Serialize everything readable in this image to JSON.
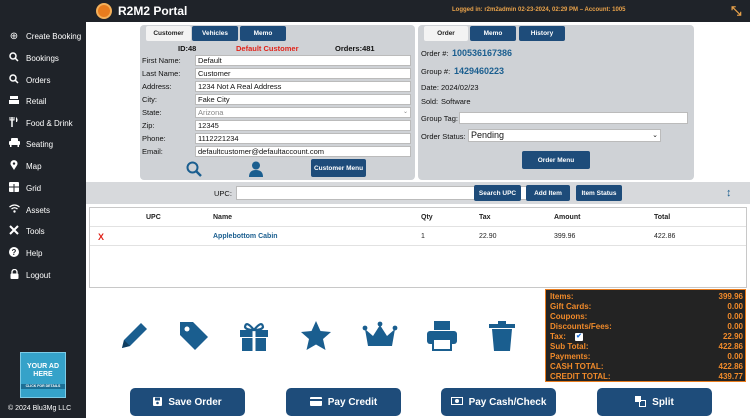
{
  "app": {
    "title": "R2M2 Portal",
    "login_info": "Logged in: r2m2admin 02-23-2024, 02:29 PM – Account: 1005"
  },
  "sidebar": {
    "items": [
      {
        "label": "Create Booking",
        "icon": "plus-circle-icon"
      },
      {
        "label": "Bookings",
        "icon": "search-icon"
      },
      {
        "label": "Orders",
        "icon": "search-icon"
      },
      {
        "label": "Retail",
        "icon": "register-icon"
      },
      {
        "label": "Food & Drink",
        "icon": "utensils-icon"
      },
      {
        "label": "Seating",
        "icon": "couch-icon"
      },
      {
        "label": "Map",
        "icon": "map-pin-icon"
      },
      {
        "label": "Grid",
        "icon": "grid-icon"
      },
      {
        "label": "Assets",
        "icon": "wifi-icon"
      },
      {
        "label": "Tools",
        "icon": "tools-icon"
      },
      {
        "label": "Help",
        "icon": "help-icon"
      },
      {
        "label": "Logout",
        "icon": "lock-icon"
      }
    ],
    "ad_line1": "YOUR AD",
    "ad_line2": "HERE",
    "ad_sub": "CLICK FOR DETAILS",
    "copyright": "© 2024 Blu3Mg LLC"
  },
  "customer": {
    "tabs": [
      "Customer",
      "Vehicles",
      "Memo"
    ],
    "id_label": "ID:48",
    "name_banner": "Default Customer",
    "orders_label": "Orders:481",
    "fields": [
      {
        "label": "First Name:",
        "value": "Default"
      },
      {
        "label": "Last Name:",
        "value": "Customer"
      },
      {
        "label": "Address:",
        "value": "1234 Not A Real Address"
      },
      {
        "label": "City:",
        "value": "Fake City"
      },
      {
        "label": "State:",
        "value": "Arizona"
      },
      {
        "label": "Zip:",
        "value": "12345"
      },
      {
        "label": "Phone:",
        "value": "1112221234"
      },
      {
        "label": "Email:",
        "value": "defaultcustomer@defaultaccount.com"
      }
    ],
    "menu_button": "Customer Menu"
  },
  "order": {
    "tabs": [
      "Order",
      "Memo",
      "History"
    ],
    "order_num_label": "Order #:",
    "order_num": "100536167386",
    "group_num_label": "Group #:",
    "group_num": "1429460223",
    "date_label": "Date:",
    "date": "2024/02/23",
    "sold_label": "Sold:",
    "sold": "Software",
    "group_tag_label": "Group Tag:",
    "group_tag": "",
    "status_label": "Order Status:",
    "status": "Pending",
    "menu_button": "Order Menu"
  },
  "upc": {
    "label": "UPC:",
    "value": "",
    "search_button": "Search UPC",
    "add_button": "Add Item",
    "status_button": "Item Status"
  },
  "items_table": {
    "headers": [
      "UPC",
      "Name",
      "Qty",
      "Tax",
      "Amount",
      "Total"
    ],
    "rows": [
      {
        "remove": "X",
        "upc": "",
        "name": "Applebottom Cabin",
        "qty": "1",
        "tax": "22.90",
        "amount": "399.96",
        "total": "422.86"
      }
    ]
  },
  "totals": {
    "rows": [
      {
        "label": "Items:",
        "value": "399.96"
      },
      {
        "label": "Gift Cards:",
        "value": "0.00"
      },
      {
        "label": "Coupons:",
        "value": "0.00"
      },
      {
        "label": "Discounts/Fees:",
        "value": "0.00"
      },
      {
        "label": "Tax:",
        "value": "22.90"
      },
      {
        "label": "Sub Total:",
        "value": "422.86"
      },
      {
        "label": "Payments:",
        "value": "0.00"
      },
      {
        "label": "CASH TOTAL:",
        "value": "422.86"
      },
      {
        "label": "CREDIT TOTAL:",
        "value": "439.77"
      }
    ]
  },
  "actions": {
    "icons": [
      "pencil-icon",
      "tag-icon",
      "gift-icon",
      "star-icon",
      "crown-icon",
      "printer-icon",
      "trash-icon"
    ],
    "buttons": [
      {
        "label": "Save Order",
        "icon": "save-icon"
      },
      {
        "label": "Pay Credit",
        "icon": "credit-card-icon"
      },
      {
        "label": "Pay Cash/Check",
        "icon": "cash-icon"
      },
      {
        "label": "Split",
        "icon": "split-icon"
      }
    ]
  },
  "colors": {
    "accent_orange": "#e87c1e",
    "button_blue": "#1e4c7a",
    "icon_blue": "#1a5e8f",
    "dark_bg": "#1f2329",
    "error_red": "#e0231a"
  }
}
